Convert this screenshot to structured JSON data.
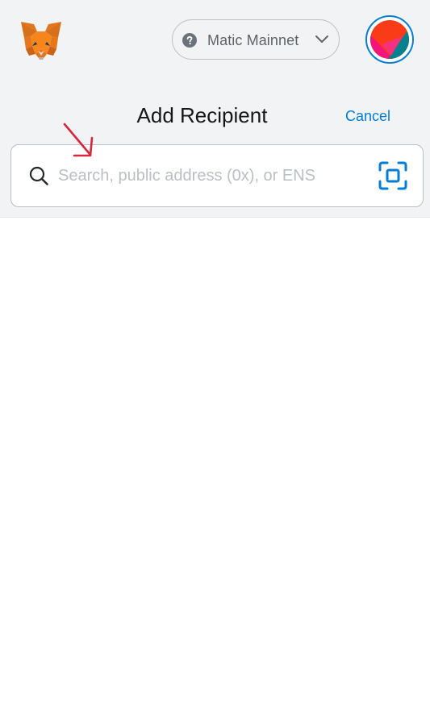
{
  "header": {
    "network": {
      "label": "Matic Mainnet",
      "status_icon": "question-circle-icon",
      "chevron_icon": "chevron-down-icon"
    },
    "logo": "metamask-fox-logo",
    "avatar": "account-identicon"
  },
  "page": {
    "title": "Add Recipient",
    "cancel_label": "Cancel"
  },
  "search": {
    "placeholder": "Search, public address (0x), or ENS",
    "value": "",
    "search_icon": "search-icon",
    "scan_icon": "qr-scan-icon"
  },
  "colors": {
    "accent": "#037dd6",
    "header_bg": "#f2f3f4",
    "annotation_arrow": "#d7263d"
  }
}
